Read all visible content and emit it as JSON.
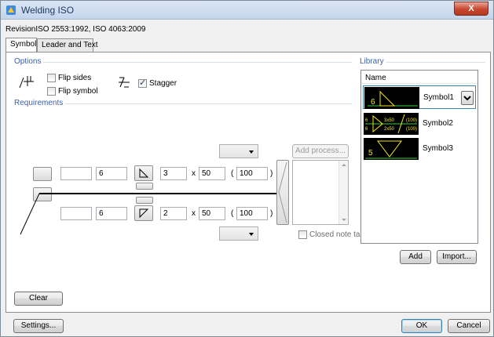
{
  "window": {
    "title": "Welding ISO",
    "close_label": "X"
  },
  "revision": "RevisionISO 2553:1992, ISO 4063:2009",
  "tabs": [
    {
      "label": "Symbol",
      "active": true
    },
    {
      "label": "Leader and Text",
      "active": false
    }
  ],
  "options": {
    "group_label": "Options",
    "flip_sides": {
      "label": "Flip sides",
      "checked": false
    },
    "flip_symbol": {
      "label": "Flip symbol",
      "checked": false
    },
    "stagger": {
      "label": "Stagger",
      "checked": true
    }
  },
  "requirements": {
    "group_label": "Requirements",
    "top": {
      "prefix": "",
      "size": "6",
      "length_a": "3",
      "times": "x",
      "length_b": "50",
      "paren_open": "(",
      "pitch": "100",
      "paren_close": ")"
    },
    "bottom": {
      "prefix": "",
      "size": "6",
      "length_a": "2",
      "times": "x",
      "length_b": "50",
      "paren_open": "(",
      "pitch": "100",
      "paren_close": ")"
    },
    "add_process_label": "Add process...",
    "closed_note_tail": {
      "label": "Closed note tail",
      "checked": false
    },
    "top_dropdown": "",
    "bottom_dropdown": ""
  },
  "library": {
    "group_label": "Library",
    "column_header": "Name",
    "items": [
      {
        "name": "Symbol1",
        "selected": true,
        "thumb_label": "6"
      },
      {
        "name": "Symbol2",
        "selected": false,
        "thumb_label_top": "3x50",
        "thumb_label_bottom": "2x50",
        "thumb_pitch_top": "(100)",
        "thumb_pitch_bottom": "(100)",
        "thumb_size_top": "6",
        "thumb_size_bottom": "6"
      },
      {
        "name": "Symbol3",
        "selected": false,
        "thumb_label": "5"
      }
    ],
    "add_label": "Add",
    "import_label": "Import..."
  },
  "clear_label": "Clear",
  "footer": {
    "settings_label": "Settings...",
    "ok_label": "OK",
    "cancel_label": "Cancel"
  },
  "colors": {
    "title_text": "#1e395b",
    "group_label": "#3a5fa8",
    "thumb_bg": "#000000",
    "thumb_yellow": "#f5e616",
    "thumb_green": "#2fd13a"
  }
}
